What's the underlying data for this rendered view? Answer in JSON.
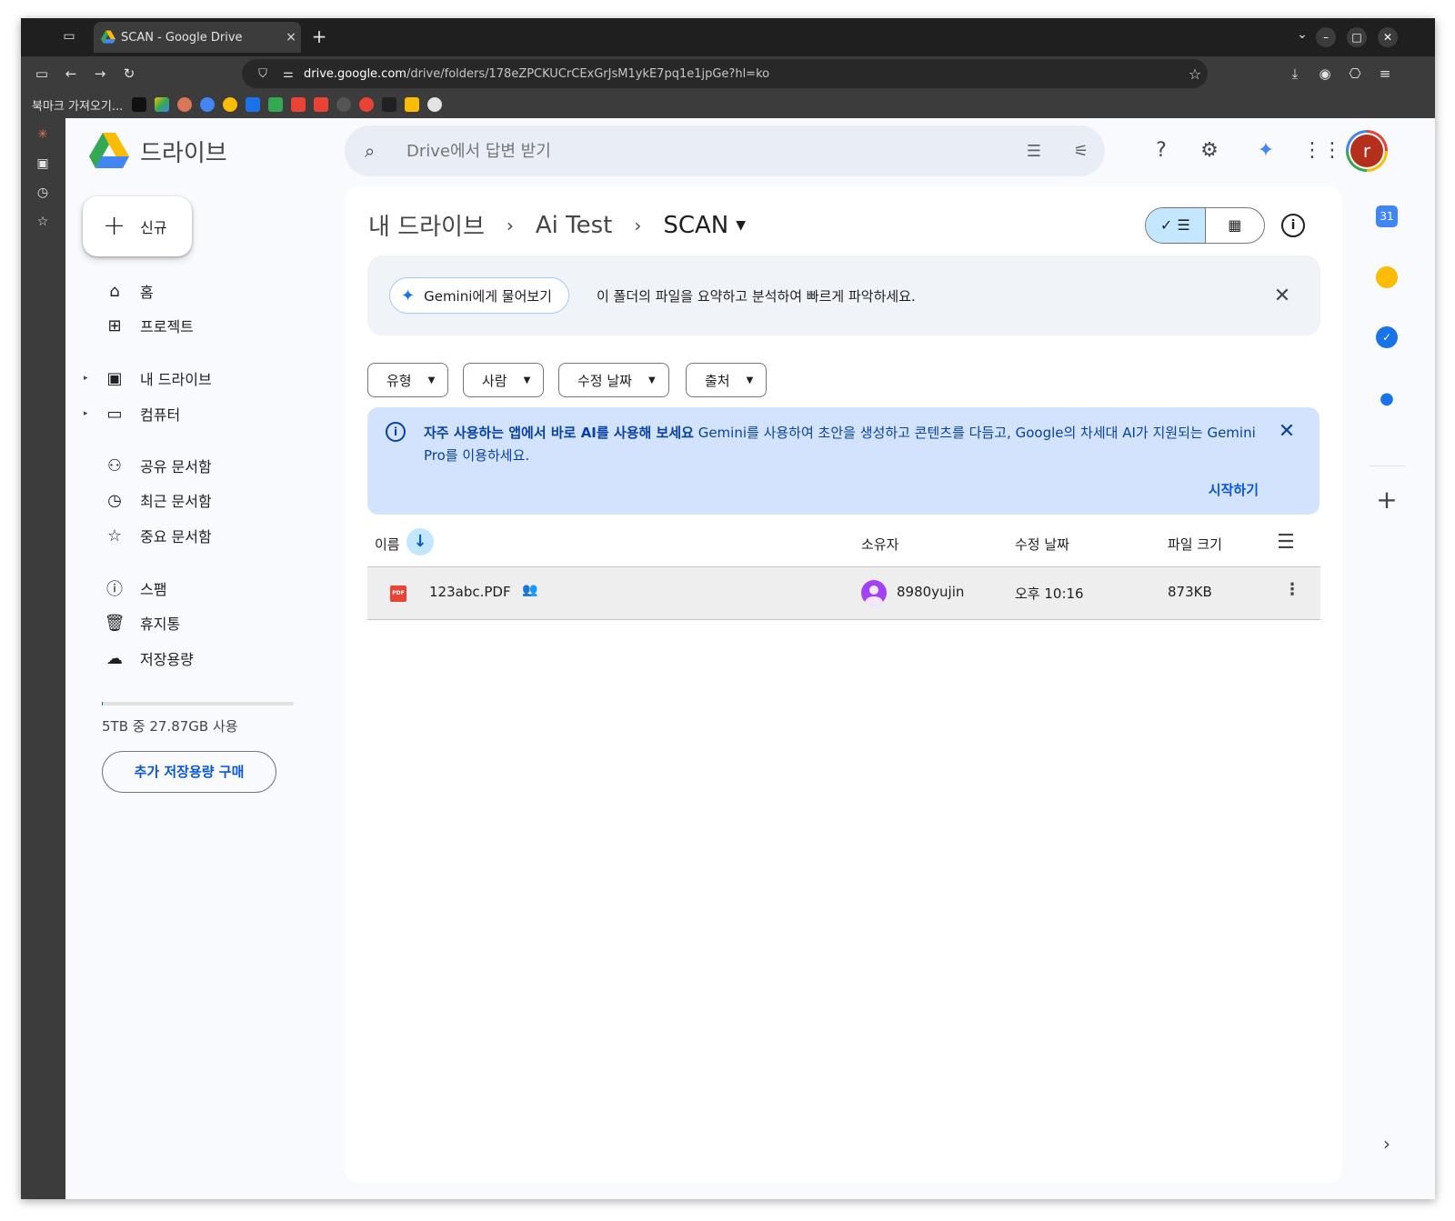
{
  "browser": {
    "tab_title": "SCAN - Google Drive",
    "tab_close": "×",
    "new_tab": "+",
    "url_host": "drive.google.com",
    "url_path": "/drive/folders/178eZPCKUCrCExGrJsM1ykE7pq1e1jpGe?hl=ko",
    "bookmarks_import": "북마크 가져오기..."
  },
  "app": {
    "name": "드라이브",
    "search_placeholder": "Drive에서 답변 받기",
    "avatar_letter": "r"
  },
  "sidebar": {
    "new_label": "신규",
    "items": [
      {
        "label": "홈",
        "icon": "home-icon"
      },
      {
        "label": "프로젝트",
        "icon": "project-icon"
      },
      {
        "label": "내 드라이브",
        "icon": "my-drive-icon"
      },
      {
        "label": "컴퓨터",
        "icon": "computer-icon"
      },
      {
        "label": "공유 문서함",
        "icon": "shared-icon"
      },
      {
        "label": "최근 문서함",
        "icon": "clock-icon"
      },
      {
        "label": "중요 문서함",
        "icon": "star-icon"
      },
      {
        "label": "스팸",
        "icon": "spam-icon"
      },
      {
        "label": "휴지통",
        "icon": "trash-icon"
      },
      {
        "label": "저장용량",
        "icon": "cloud-icon"
      }
    ],
    "quota_text": "5TB 중 27.87GB 사용",
    "quota_fraction": 0.0054,
    "buy_storage": "추가 저장용량 구매"
  },
  "breadcrumb": {
    "root": "내 드라이브",
    "middle": "Ai Test",
    "current": "SCAN"
  },
  "gemini_bar": {
    "button": "Gemini에게 물어보기",
    "text": "이 폴더의 파일을 요약하고 분석하여 빠르게 파악하세요."
  },
  "filters": [
    "유형",
    "사람",
    "수정 날짜",
    "출처"
  ],
  "notice": {
    "bold": "자주 사용하는 앱에서 바로 AI를 사용해 보세요",
    "text": " Gemini를 사용하여 초안을 생성하고 콘텐츠를 다듬고, Google의 차세대 AI가 지원되는 Gemini Pro를 이용하세요.",
    "action": "시작하기"
  },
  "table": {
    "headers": {
      "name": "이름",
      "owner": "소유자",
      "modified": "수정 날짜",
      "size": "파일 크기"
    },
    "rows": [
      {
        "name": "123abc.PDF",
        "owner": "8980yujin",
        "modified": "오후 10:16",
        "size": "873KB",
        "type_badge": "PDF"
      }
    ]
  },
  "right_panel": {
    "calendar_badge": "31"
  }
}
